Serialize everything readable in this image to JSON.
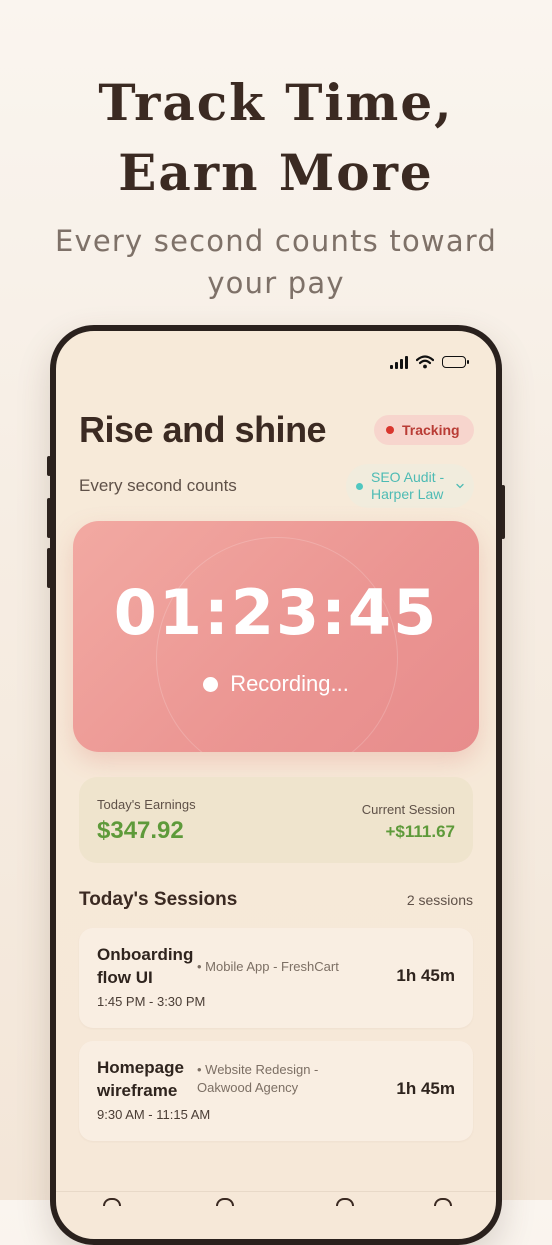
{
  "hero": {
    "title_line1": "Track Time,",
    "title_line2": "Earn More",
    "subtitle": "Every second counts toward your pay"
  },
  "app": {
    "greeting": "Rise and shine",
    "status_badge": "Tracking",
    "tagline": "Every second counts",
    "project_selector": "SEO Audit - Harper Law",
    "timer": {
      "display": "01:23:45",
      "state": "Recording..."
    },
    "earnings": {
      "today_label": "Today's Earnings",
      "today_value": "$347.92",
      "session_label": "Current Session",
      "session_value": "+$111.67"
    },
    "sessions": {
      "title": "Today's Sessions",
      "count": "2 sessions",
      "items": [
        {
          "title": "Onboarding flow UI",
          "project": "• Mobile App - FreshCart",
          "time": "1:45 PM  - 3:30 PM",
          "duration": "1h 45m"
        },
        {
          "title": "Homepage wireframe",
          "project": "• Website Redesign - Oakwood Agency",
          "time": "9:30 AM  - 11:15 AM",
          "duration": "1h 45m"
        }
      ]
    }
  },
  "colors": {
    "accent_timer": "#eb9592",
    "earnings_green": "#5e9a3a",
    "tracking_red": "#d9362e",
    "project_teal": "#4dbbb4",
    "heading_brown": "#3b2a22"
  },
  "icons": [
    "signal-icon",
    "wifi-icon",
    "battery-icon",
    "chevron-down-icon",
    "recording-dot-icon"
  ]
}
